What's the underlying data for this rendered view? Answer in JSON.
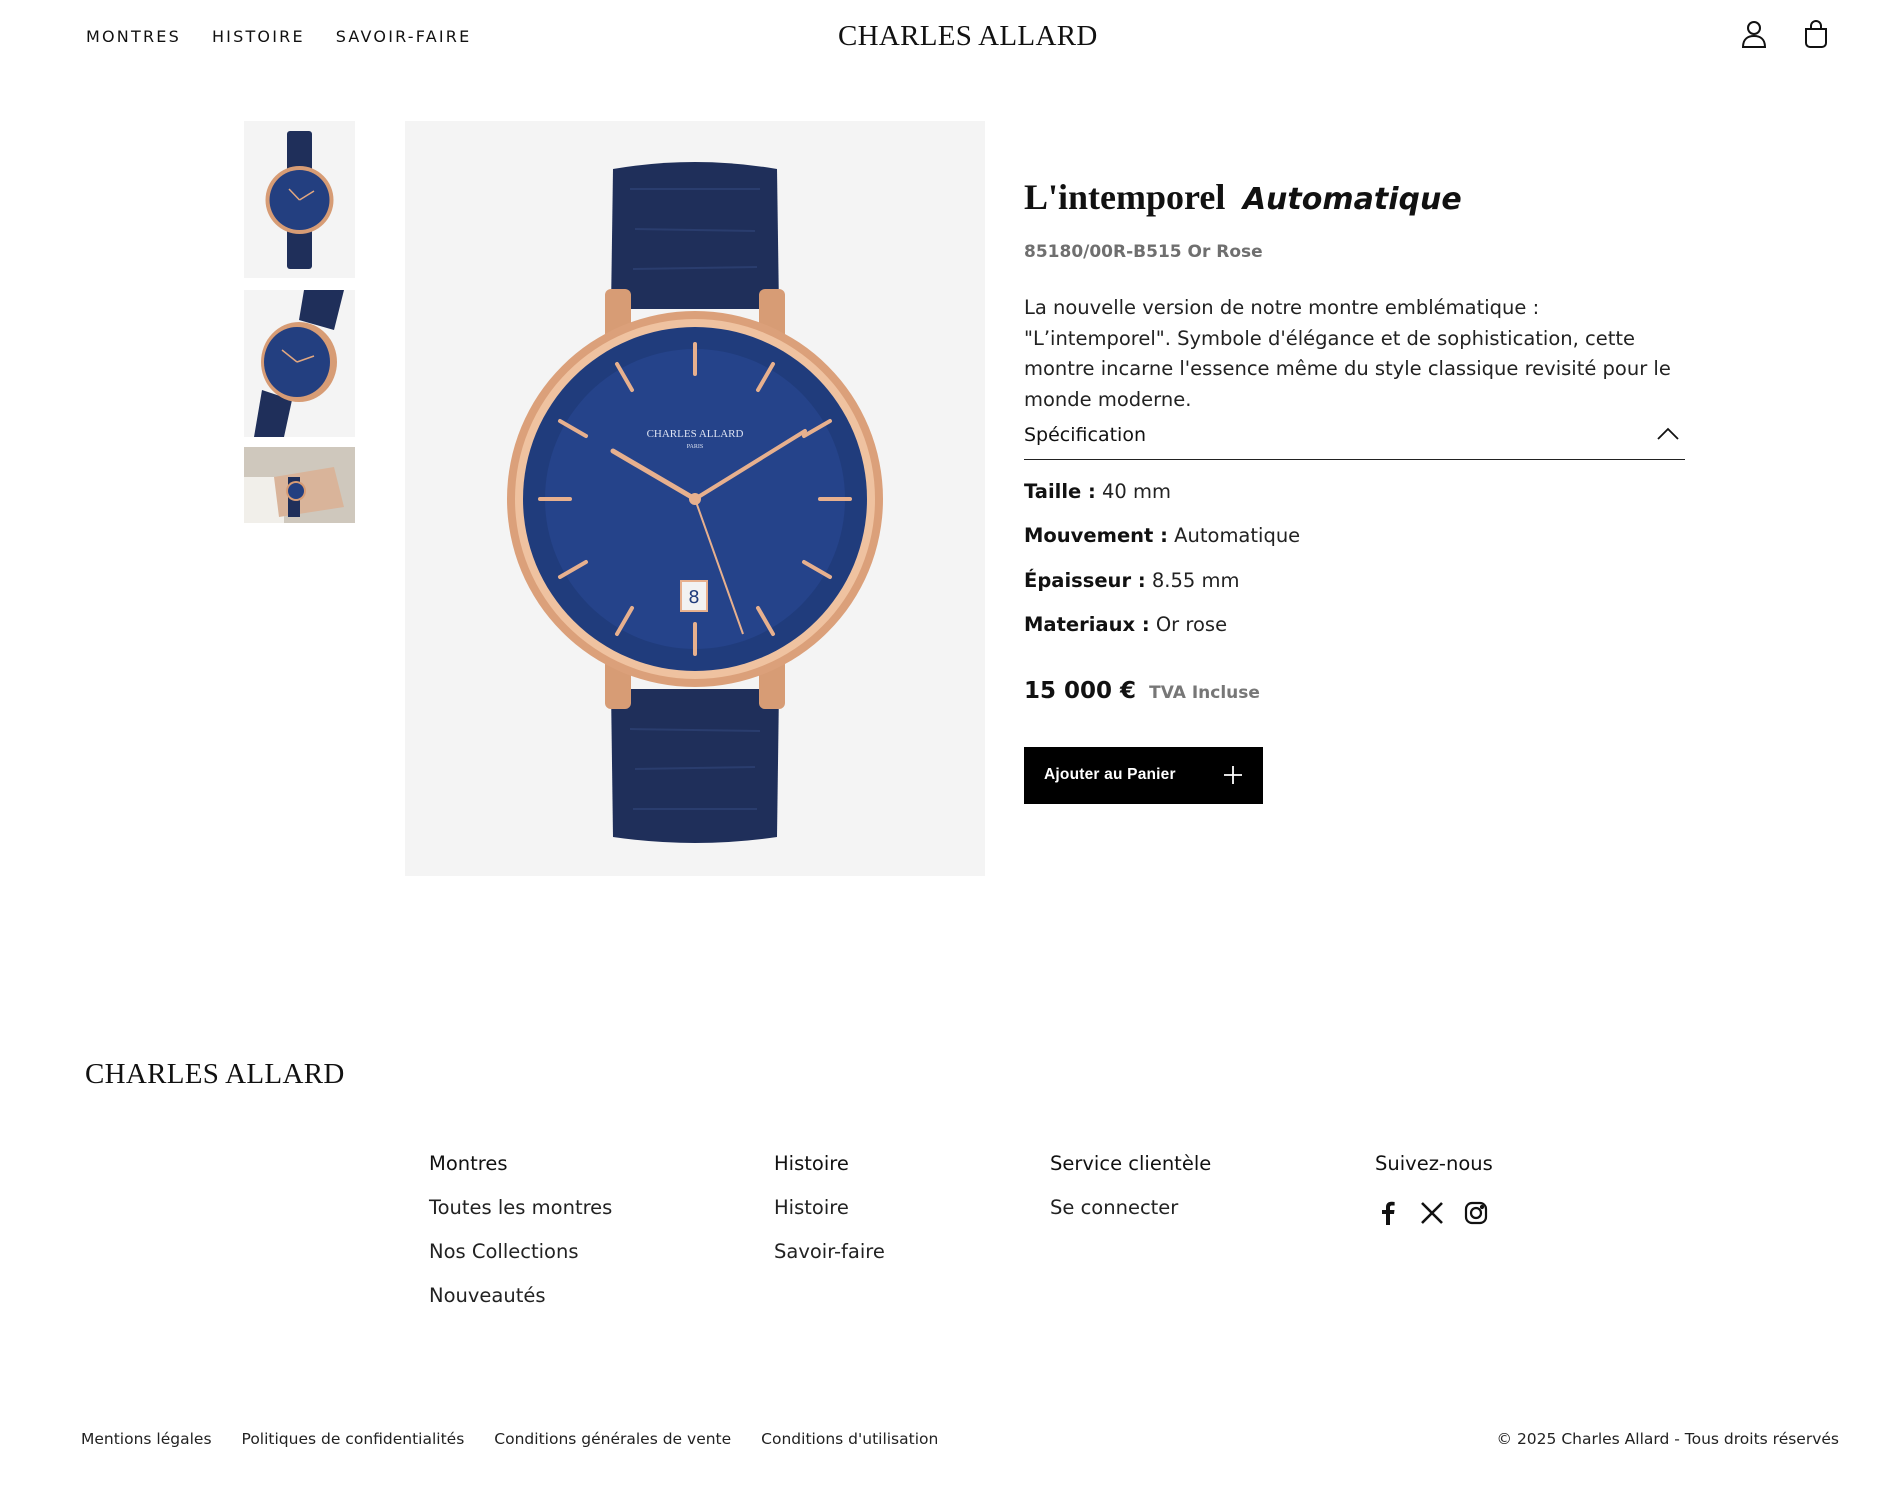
{
  "header": {
    "nav": [
      "MONTRES",
      "HISTOIRE",
      "SAVOIR-FAIRE"
    ],
    "logo": "CHARLES ALLARD",
    "icons": [
      "user-icon",
      "shopping-bag-icon"
    ]
  },
  "gallery": {
    "thumbnails": [
      "watch-front-thumbnail",
      "watch-angle-thumbnail",
      "watch-wrist-thumbnail"
    ],
    "main_image": "watch-main-image",
    "dial_brand": "CHARLES ALLARD",
    "dial_city": "PARIS",
    "date": "8"
  },
  "product": {
    "title_main": "L'intemporel",
    "title_italic": "Automatique",
    "reference": "85180/00R-B515 Or Rose",
    "description": "La nouvelle version de notre montre emblématique : \"L’intemporel\". Symbole d'élégance et de sophistication, cette montre incarne l'essence même du style classique revisité pour le monde moderne.",
    "spec_title": "Spécification",
    "specs": [
      {
        "label": "Taille :",
        "value": " 40 mm"
      },
      {
        "label": "Mouvement :",
        "value": " Automatique"
      },
      {
        "label": "Épaisseur :",
        "value": " 8.55 mm"
      },
      {
        "label": "Materiaux :",
        "value": " Or rose"
      }
    ],
    "price": "15 000 €",
    "tax_note": "TVA Incluse",
    "add_to_cart": "Ajouter au Panier"
  },
  "footer": {
    "logo": "CHARLES ALLARD",
    "columns": [
      {
        "title": "Montres",
        "links": [
          "Toutes les montres",
          "Nos Collections",
          "Nouveautés"
        ]
      },
      {
        "title": "Histoire",
        "links": [
          "Histoire",
          "Savoir-faire"
        ]
      },
      {
        "title": "Service clientèle",
        "links": [
          "Se connecter"
        ]
      },
      {
        "title": "Suivez-nous",
        "links": []
      }
    ],
    "social": [
      "facebook-icon",
      "x-icon",
      "instagram-icon"
    ],
    "legal": [
      "Mentions légales",
      "Politiques de confidentialités",
      "Conditions générales de vente",
      "Conditions d'utilisation"
    ],
    "copyright": "© 2025 Charles Allard - Tous droits réservés"
  },
  "colors": {
    "text": "#111111",
    "muted": "#6f6f6f",
    "button_bg": "#000000",
    "image_bg": "#f4f4f4",
    "dial": "#1f3a78",
    "gold": "#e2a77f"
  }
}
